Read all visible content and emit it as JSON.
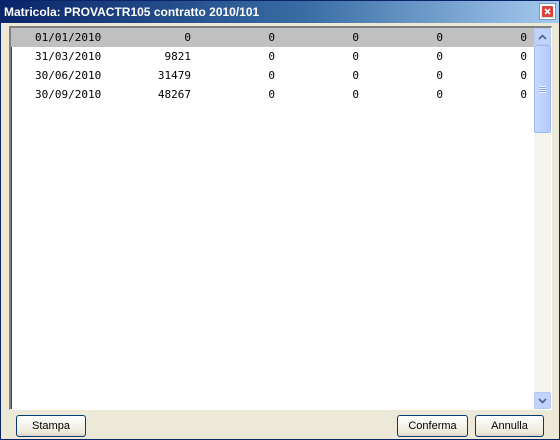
{
  "window": {
    "title": "Matricola: PROVACTR105 contratto 2010/101",
    "close_icon": "close-icon",
    "colors": {
      "titlebar": "#0a246a",
      "close": "#d9443a",
      "selected_row": "#c0c0c0"
    }
  },
  "list": {
    "selected_index": 0,
    "rows": [
      [
        "01/01/2010",
        "0",
        "0",
        "0",
        "0",
        "0"
      ],
      [
        "31/03/2010",
        "9821",
        "0",
        "0",
        "0",
        "0"
      ],
      [
        "30/06/2010",
        "31479",
        "0",
        "0",
        "0",
        "0"
      ],
      [
        "30/09/2010",
        "48267",
        "0",
        "0",
        "0",
        "0"
      ]
    ]
  },
  "buttons": {
    "stampa": "Stampa",
    "conferma": "Conferma",
    "annulla": "Annulla"
  }
}
